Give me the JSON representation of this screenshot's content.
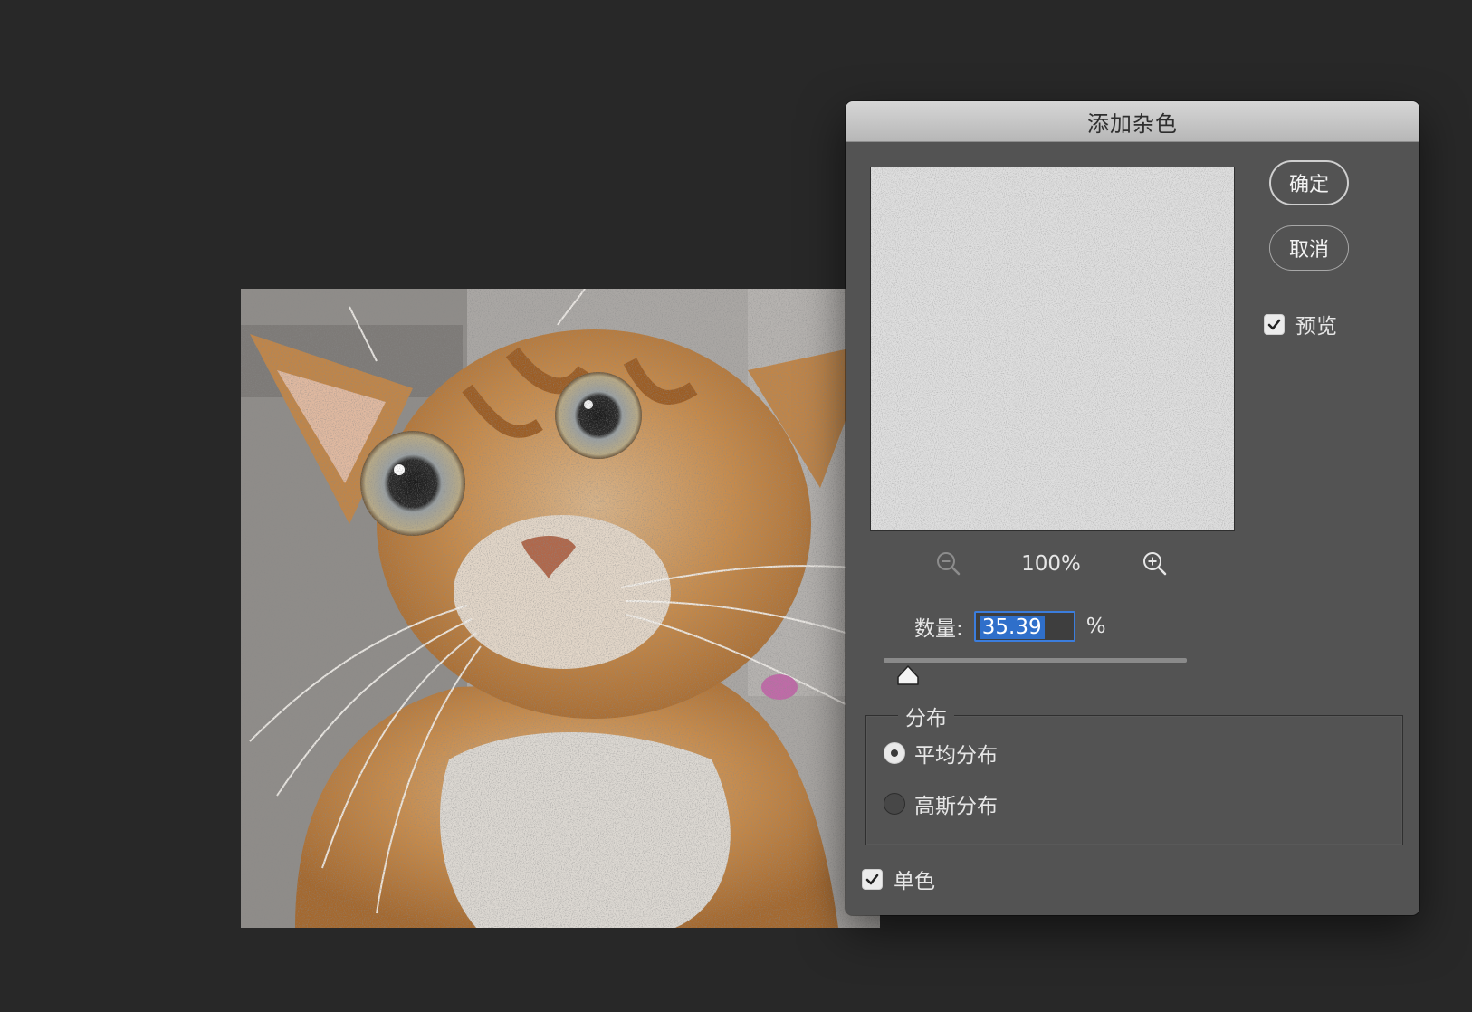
{
  "canvas": {
    "image_description_name": "cat-photo"
  },
  "dialog": {
    "title": "添加杂色",
    "buttons": {
      "ok": "确定",
      "cancel": "取消"
    },
    "preview": {
      "label": "预览",
      "checked": true
    },
    "zoom": {
      "level": "100%"
    },
    "amount": {
      "label": "数量:",
      "value": "35.39",
      "unit": "%",
      "slider_fraction": 0.08
    },
    "distribution": {
      "legend": "分布",
      "options": [
        {
          "label": "平均分布",
          "selected": true
        },
        {
          "label": "高斯分布",
          "selected": false
        }
      ]
    },
    "monochromatic": {
      "label": "单色",
      "checked": true
    }
  },
  "colors": {
    "background": "#282828",
    "dialog": "#535353",
    "accent": "#3b7ddd"
  }
}
